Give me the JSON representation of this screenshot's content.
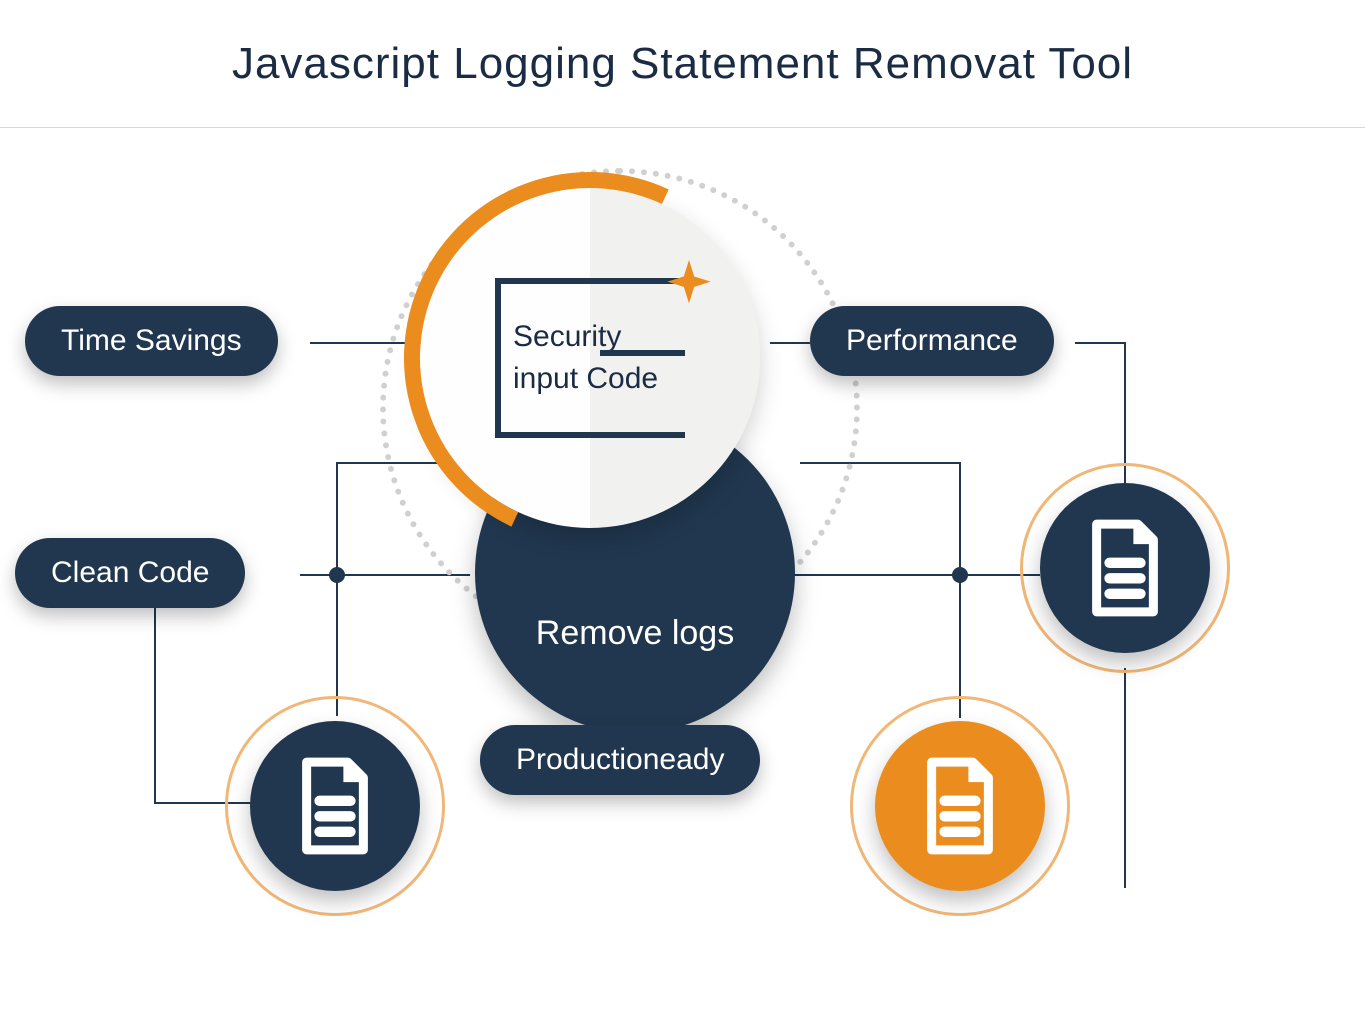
{
  "header": {
    "title": "Javascript Logging Statement Removat Tool"
  },
  "pills": {
    "time_savings": "Time Savings",
    "performance": "Performance",
    "clean_code": "Clean Code",
    "production_ready": "Productioneady"
  },
  "center": {
    "line1": "Security",
    "line2": "input Code",
    "remove_logs": "Remove logs"
  },
  "icons": {
    "document": "document-icon",
    "sparkle": "sparkle-icon"
  },
  "colors": {
    "navy": "#20374f",
    "orange": "#eb8c1e",
    "ring": "#f0b777"
  }
}
